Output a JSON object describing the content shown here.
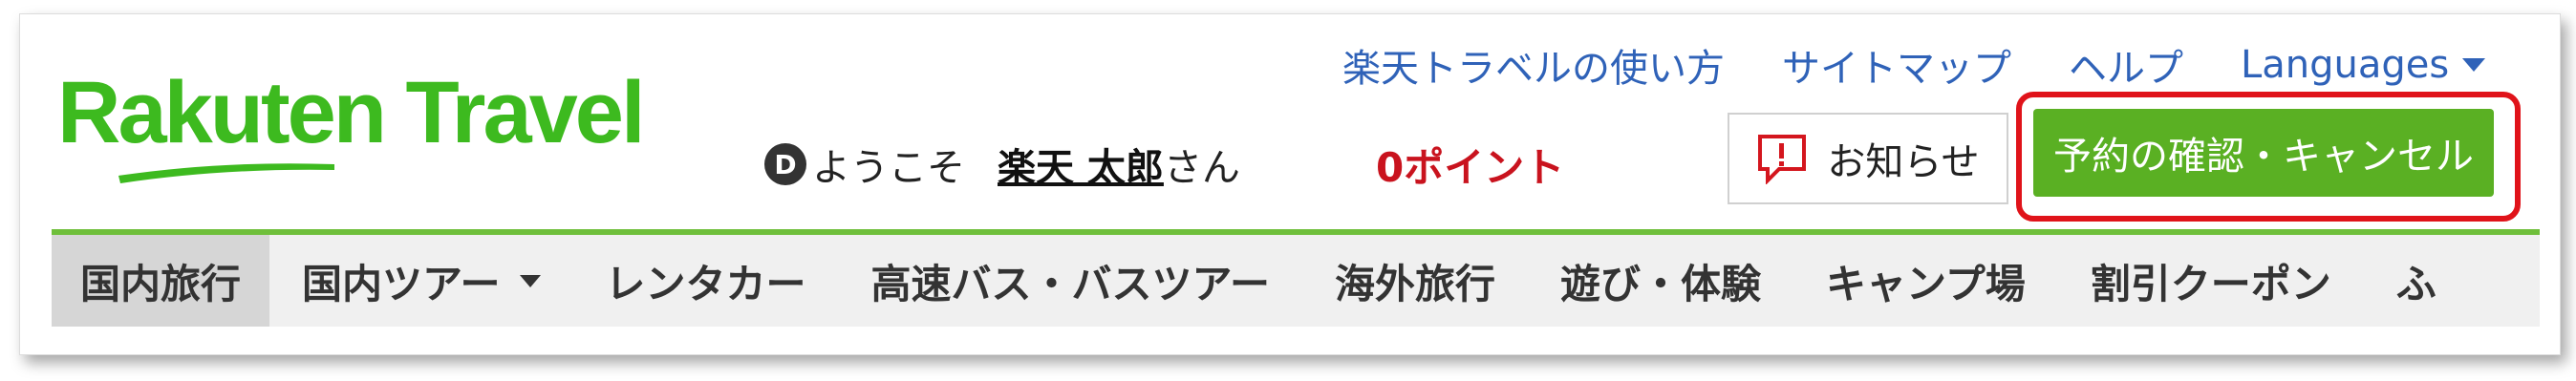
{
  "brand": {
    "logo_text": "Rakuten Travel",
    "color": "#3dba1f"
  },
  "top_links": [
    {
      "label": "楽天トラベルの使い方"
    },
    {
      "label": "サイトマップ"
    },
    {
      "label": "ヘルプ"
    },
    {
      "label": "Languages"
    }
  ],
  "user": {
    "badge": "D",
    "greeting": "ようこそ",
    "name": "楽天 太郎",
    "suffix": "さん",
    "points": "0ポイント"
  },
  "notice_label": "お知らせ",
  "reserve_label": "予約の確認・キャンセル",
  "colors": {
    "accent_green": "#5ab023",
    "highlight_red": "#e0131a",
    "link_blue": "#2f62b8",
    "points_red": "#c9131e"
  },
  "nav": [
    {
      "label": "国内旅行",
      "active": true
    },
    {
      "label": "国内ツアー",
      "dropdown": true
    },
    {
      "label": "レンタカー"
    },
    {
      "label": "高速バス・バスツアー"
    },
    {
      "label": "海外旅行"
    },
    {
      "label": "遊び・体験"
    },
    {
      "label": "キャンプ場"
    },
    {
      "label": "割引クーポン"
    },
    {
      "label": "ふ"
    }
  ]
}
